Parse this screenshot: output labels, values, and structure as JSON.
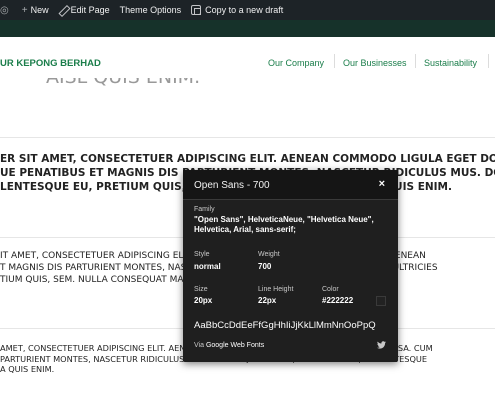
{
  "admin_bar": {
    "items": [
      {
        "label": ""
      },
      {
        "icon": "plus-icon",
        "label": "New"
      },
      {
        "icon": "pencil-icon",
        "label": "Edit Page"
      },
      {
        "label": "Theme Options"
      },
      {
        "icon": "copy-icon",
        "label": "Copy to a new draft"
      }
    ]
  },
  "header": {
    "brand": "UR KEPONG BERHAD",
    "nav": [
      "Our Company",
      "Our Businesses",
      "Sustainability"
    ]
  },
  "section_title": "AISL  QUIS ENIM.",
  "paragraphs": [
    {
      "lines": [
        "ER SIT AMET, CONSECTETUER ADIPISCING ELIT. AENEAN COMMODO LIGULA EGET DOLOR.",
        "UE PENATIBUS ET MAGNIS DIS PARTURIENT MONTES, NASCETUR RIDICULUS MUS. DONEC",
        "LENTESQUE EU, PRETIUM QUIS, SEM. NULLA CONSEQUAT MASSA QUIS ENIM."
      ]
    },
    {
      "lines": [
        "IT AMET, CONSECTETUER ADIPISCING ELIT. AENEAN COMMODO LIGULA EGET DOLOR. AENEAN",
        "T MAGNIS DIS PARTURIENT MONTES, NASCETUR RIDICULUS MUS. DONEC QUAM FELIS, ULTRICIES",
        "TIUM QUIS, SEM. NULLA CONSEQUAT MASSA QUIS ENIM."
      ]
    },
    {
      "lines": [
        "AMET, CONSECTETUER ADIPISCING ELIT. AENEAN COMMODO LIGULA EGET DOLOR. AENEAN MASSA. CUM",
        "PARTURIENT MONTES, NASCETUR RIDICULUS MUS. DONEC QUAM FELIS, ULTRICIES NEC, PELLENTESQUE",
        "A QUIS ENIM."
      ]
    }
  ],
  "font_popup": {
    "title": "Open Sans - 700",
    "close": "×",
    "family_label": "Family",
    "family_value": "\"Open Sans\", HelveticaNeue, \"Helvetica Neue\", Helvetica, Arial, sans-serif;",
    "style_label": "Style",
    "style_value": "normal",
    "weight_label": "Weight",
    "weight_value": "700",
    "size_label": "Size",
    "size_value": "20px",
    "line_height_label": "Line Height",
    "line_height_value": "22px",
    "color_label": "Color",
    "color_value": "#222222",
    "sample": "AaBbCcDdEeFfGgHhIiJjKkLlMmNnOoPpQ",
    "footer_prefix": "Via",
    "footer_link": "Google Web Fonts",
    "footer_icon": "twitter-icon"
  },
  "colors": {
    "admin_bar": "#1d2327",
    "band": "#16322a",
    "brand_green": "#1a7d4a",
    "popup_bg": "#1f1f1f",
    "text": "#222222"
  }
}
